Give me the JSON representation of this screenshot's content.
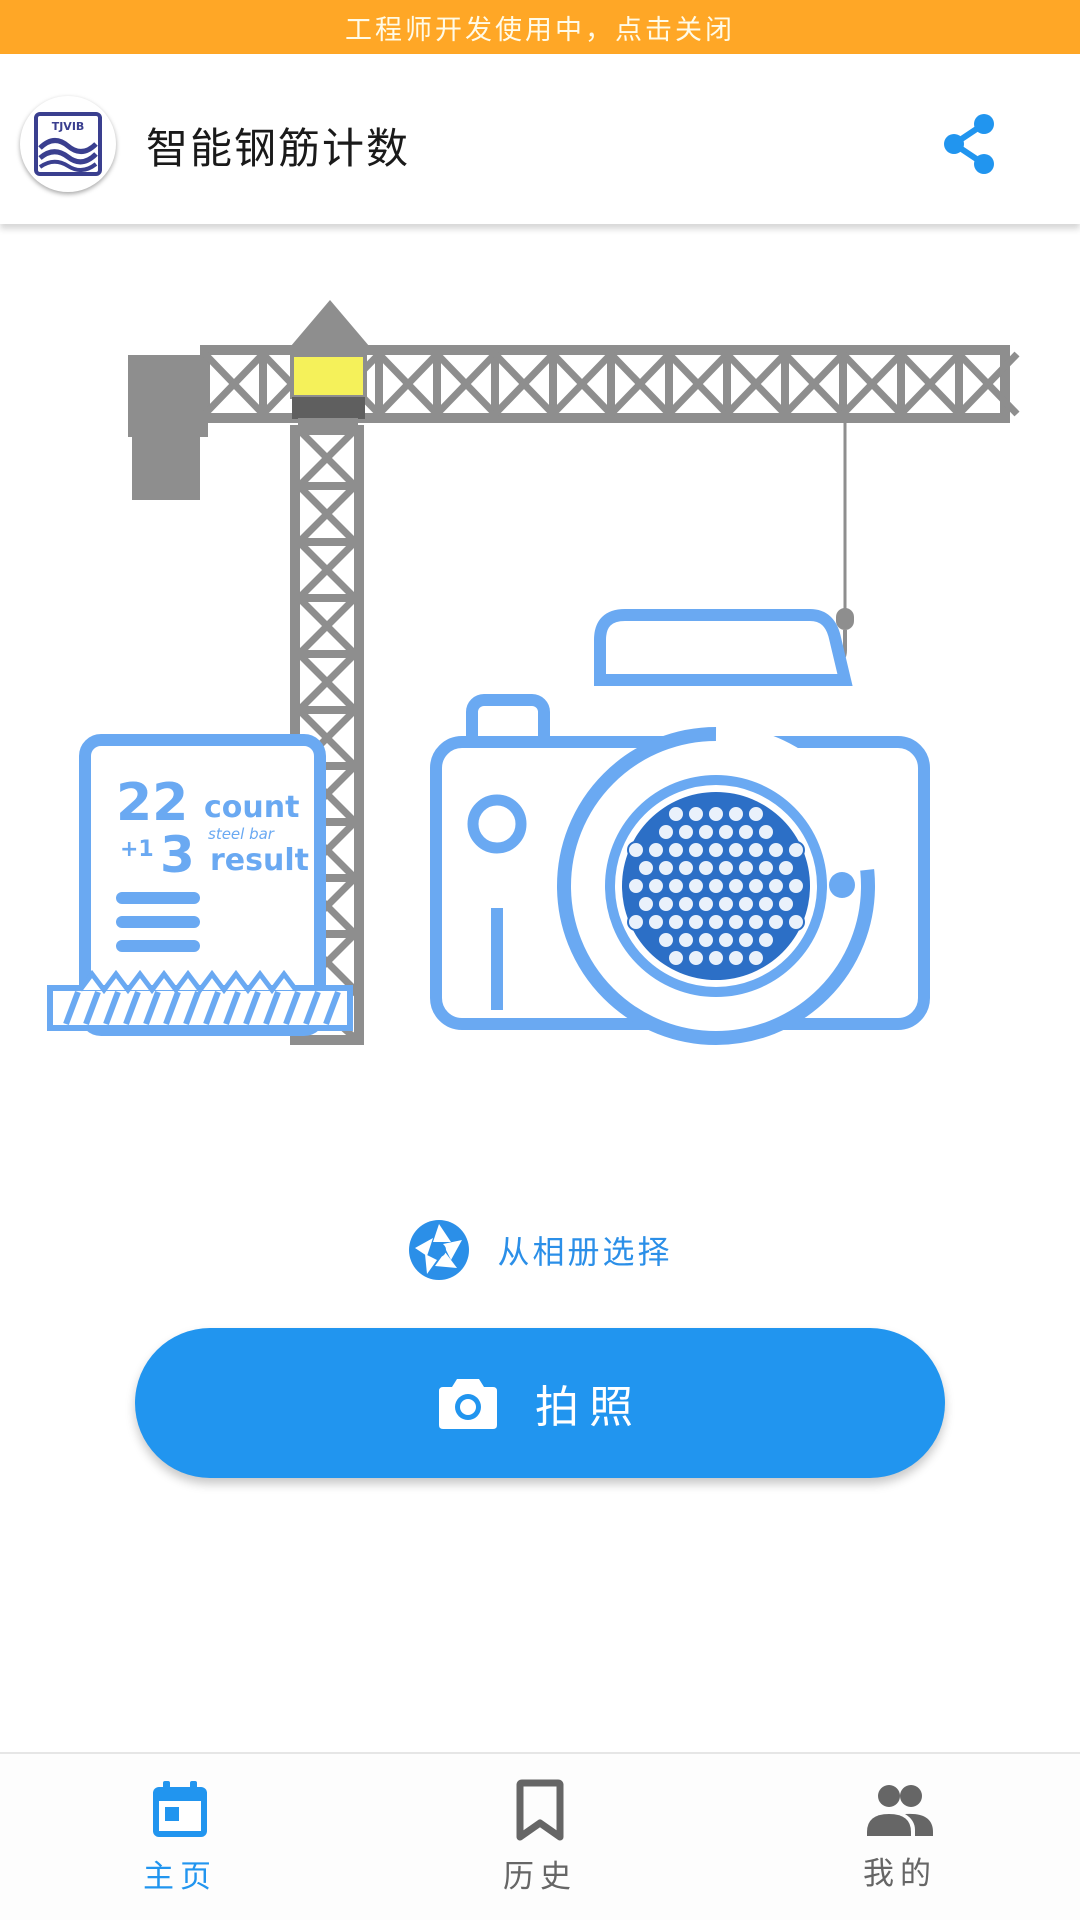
{
  "dev_banner": {
    "text": "工程师开发使用中，点击关闭"
  },
  "app_bar": {
    "title": "智能钢筋计数",
    "logo_text": "TJVIB",
    "logo_icon": "app-logo",
    "share_icon": "share-icon"
  },
  "illustration": {
    "card_numbers": {
      "top": "22",
      "plus": "+1",
      "bottom": "3"
    },
    "card_words": {
      "count": "count",
      "steel_bar": "steel bar",
      "result": "result"
    }
  },
  "actions": {
    "album_label": "从相册选择",
    "album_icon": "aperture-icon",
    "photo_label": "拍照",
    "photo_icon": "camera-icon"
  },
  "bottom_nav": {
    "items": [
      {
        "label": "主页",
        "icon": "calendar-icon",
        "active": true
      },
      {
        "label": "历史",
        "icon": "bookmark-icon",
        "active": false
      },
      {
        "label": "我的",
        "icon": "people-icon",
        "active": false
      }
    ]
  },
  "colors": {
    "banner": "#ffa726",
    "accent": "#2195ef",
    "crane": "#8e8e8e",
    "illustration_blue": "#6aa9f2",
    "nav_inactive": "#666666"
  }
}
